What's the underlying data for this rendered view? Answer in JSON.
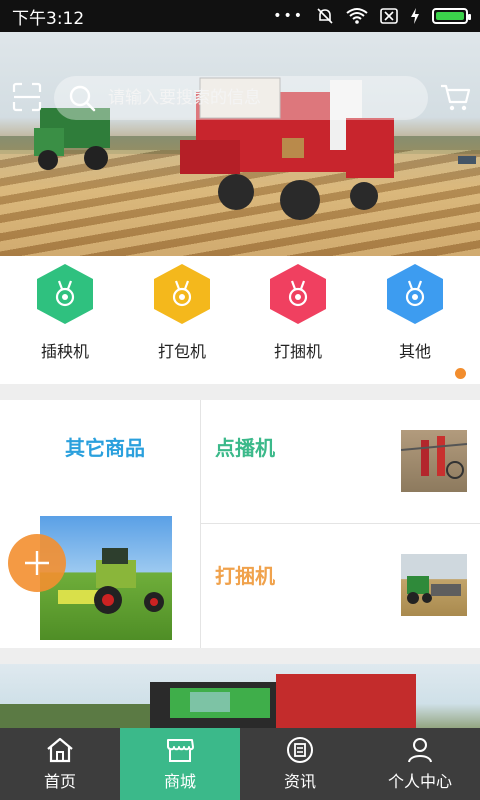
{
  "status_bar": {
    "time": "下午3:12"
  },
  "search": {
    "placeholder": "请输入要搜索的信息"
  },
  "categories": [
    {
      "label": "插秧机",
      "color": "#2fc17f"
    },
    {
      "label": "打包机",
      "color": "#f4b81c"
    },
    {
      "label": "打捆机",
      "color": "#f04060"
    },
    {
      "label": "其他",
      "color": "#3d9cf0"
    }
  ],
  "products": {
    "left_title": "其它商品",
    "right_items": [
      {
        "title": "点播机",
        "color": "#3bb98a"
      },
      {
        "title": "打捆机",
        "color": "#f0a24c"
      }
    ]
  },
  "tabs": [
    {
      "label": "首页",
      "icon": "home-icon"
    },
    {
      "label": "商城",
      "icon": "shop-icon",
      "active": true
    },
    {
      "label": "资讯",
      "icon": "news-icon"
    },
    {
      "label": "个人中心",
      "icon": "user-icon"
    }
  ]
}
